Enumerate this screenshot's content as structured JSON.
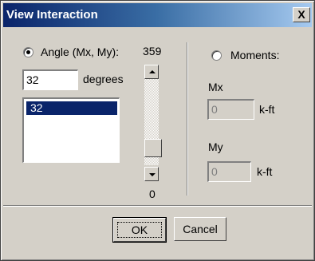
{
  "window": {
    "title": "View Interaction",
    "close_label": "X"
  },
  "angle": {
    "radio_label": "Angle (Mx, My):",
    "selected": true,
    "value": "32",
    "unit": "degrees",
    "list_items": [
      "32"
    ]
  },
  "slider": {
    "max_label": "359",
    "min_label": "0",
    "value": 32
  },
  "moments": {
    "radio_label": "Moments:",
    "selected": false,
    "mx_label": "Mx",
    "mx_value": "0",
    "mx_unit": "k-ft",
    "my_label": "My",
    "my_value": "0",
    "my_unit": "k-ft"
  },
  "buttons": {
    "ok_label": "OK",
    "cancel_label": "Cancel"
  },
  "colors": {
    "title_bar": "#0a246a",
    "selection": "#0a246a",
    "face": "#d4d0c8"
  }
}
